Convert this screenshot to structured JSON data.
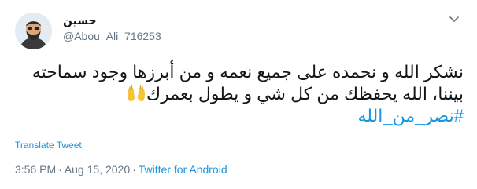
{
  "author": {
    "display_name": "حسين",
    "handle": "@Abou_Ali_716253",
    "avatar_icon": "avatar-icon"
  },
  "menu": {
    "icon": "chevron-down-icon"
  },
  "tweet": {
    "line1": "نشكر الله و نحمده على جميع نعمه و من أبرزها وجود سماحته",
    "line2": "بيننا، الله يحفظك من كل شي و يطول بعمرك",
    "line2_emoji_icon": "raised-hands-icon",
    "hashtag": "#نصر_من_الله"
  },
  "translate_label": "Translate Tweet",
  "meta": {
    "time": "3:56 PM",
    "separator": "·",
    "date": "Aug 15, 2020",
    "source": "Twitter for Android"
  },
  "colors": {
    "link": "#1b95e0",
    "secondary_text": "#657786",
    "primary_text": "#14171a",
    "divider": "#e6ecf0"
  }
}
